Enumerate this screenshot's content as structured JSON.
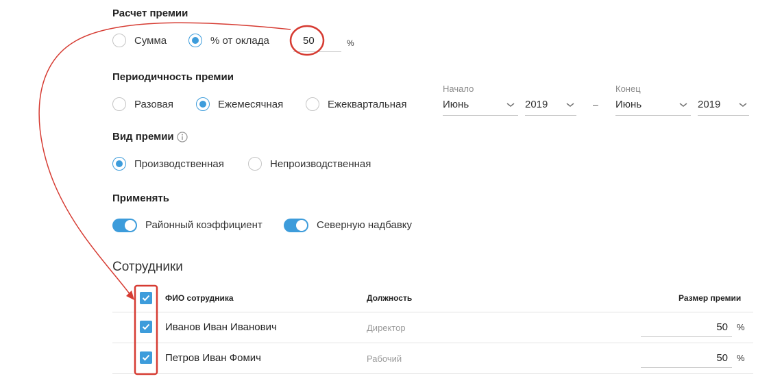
{
  "bonus_calc": {
    "title": "Расчет премии",
    "options": [
      {
        "label": "Сумма",
        "selected": false
      },
      {
        "label": "% от оклада",
        "selected": true
      }
    ],
    "value": "50",
    "unit": "%"
  },
  "periodicity": {
    "title": "Периодичность премии",
    "options": [
      {
        "label": "Разовая",
        "selected": false
      },
      {
        "label": "Ежемесячная",
        "selected": true
      },
      {
        "label": "Ежеквартальная",
        "selected": false
      }
    ],
    "start": {
      "label": "Начало",
      "month": "Июнь",
      "year": "2019"
    },
    "dash": "–",
    "end": {
      "label": "Конец",
      "month": "Июнь",
      "year": "2019"
    }
  },
  "bonus_type": {
    "title": "Вид премии",
    "options": [
      {
        "label": "Производственная",
        "selected": true
      },
      {
        "label": "Непроизводственная",
        "selected": false
      }
    ]
  },
  "apply": {
    "title": "Применять",
    "toggles": [
      {
        "label": "Районный коэффициент",
        "on": true
      },
      {
        "label": "Северную надбавку",
        "on": true
      }
    ]
  },
  "employees": {
    "title": "Сотрудники",
    "columns": {
      "name": "ФИО сотрудника",
      "position": "Должность",
      "bonus": "Размер премии"
    },
    "rows": [
      {
        "name": "Иванов Иван Иванович",
        "position": "Директор",
        "bonus": "50",
        "unit": "%",
        "checked": true
      },
      {
        "name": "Петров Иван Фомич",
        "position": "Рабочий",
        "bonus": "50",
        "unit": "%",
        "checked": true
      }
    ]
  },
  "colors": {
    "accent": "#3d9cdb",
    "annotation": "#d63b32"
  }
}
